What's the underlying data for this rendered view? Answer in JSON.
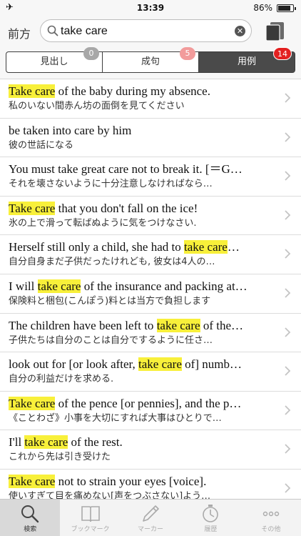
{
  "status_bar": {
    "time": "13:39",
    "battery": "86%",
    "battery_level": 0.86
  },
  "search": {
    "prefix_label": "前方",
    "query": "take care"
  },
  "segments": [
    {
      "label": "見出し",
      "count": "0"
    },
    {
      "label": "成句",
      "count": "5"
    },
    {
      "label": "用例",
      "count": "14",
      "active": true
    }
  ],
  "results": [
    {
      "en": [
        {
          "t": "Take care",
          "h": true
        },
        {
          "t": " of the baby during my absence.",
          "h": false
        }
      ],
      "jp": "私のいない間赤ん坊の面倒を見てください"
    },
    {
      "en": [
        {
          "t": "be taken into care by him",
          "h": false
        }
      ],
      "jp": "彼の世話になる"
    },
    {
      "en": [
        {
          "t": "You must take great care not to break it. [＝G…",
          "h": false
        }
      ],
      "jp": "それを壊さないように十分注意しなければなら…"
    },
    {
      "en": [
        {
          "t": "Take care",
          "h": true
        },
        {
          "t": " that you don't fall on the ice!",
          "h": false
        }
      ],
      "jp": "氷の上で滑って転ばぬように気をつけなさい."
    },
    {
      "en": [
        {
          "t": "Herself still only a child, she had to ",
          "h": false
        },
        {
          "t": "take care",
          "h": true
        },
        {
          "t": "…",
          "h": false
        }
      ],
      "jp": "自分自身まだ子供だったけれども, 彼女は4人の…"
    },
    {
      "en": [
        {
          "t": "I will ",
          "h": false
        },
        {
          "t": "take care",
          "h": true
        },
        {
          "t": " of the insurance and packing at…",
          "h": false
        }
      ],
      "jp": "保険料と梱包(こんぽう)料とは当方で負担します"
    },
    {
      "en": [
        {
          "t": "The children have been left to ",
          "h": false
        },
        {
          "t": "take care",
          "h": true
        },
        {
          "t": " of the…",
          "h": false
        }
      ],
      "jp": "子供たちは自分のことは自分でするように任さ…"
    },
    {
      "en": [
        {
          "t": "look out for [or look after, ",
          "h": false
        },
        {
          "t": "take care",
          "h": true
        },
        {
          "t": " of] numb…",
          "h": false
        }
      ],
      "jp": "自分の利益だけを求める."
    },
    {
      "en": [
        {
          "t": "Take care",
          "h": true
        },
        {
          "t": " of the pence [or pennies], and the p…",
          "h": false
        }
      ],
      "jp": "《ことわざ》小事を大切にすれば大事はひとりで…"
    },
    {
      "en": [
        {
          "t": "I'll ",
          "h": false
        },
        {
          "t": "take care",
          "h": true
        },
        {
          "t": " of the rest.",
          "h": false
        }
      ],
      "jp": "これから先は引き受けた"
    },
    {
      "en": [
        {
          "t": "Take care",
          "h": true
        },
        {
          "t": " not to strain your eyes [voice].",
          "h": false
        }
      ],
      "jp": "使いすぎて目を痛めない[声をつぶさない]よう…"
    }
  ],
  "tabs": [
    {
      "label": "検索",
      "icon": "search-icon",
      "active": true
    },
    {
      "label": "ブックマーク",
      "icon": "book-icon"
    },
    {
      "label": "マーカー",
      "icon": "pen-icon"
    },
    {
      "label": "履歴",
      "icon": "history-icon"
    },
    {
      "label": "その他",
      "icon": "more-icon"
    }
  ]
}
